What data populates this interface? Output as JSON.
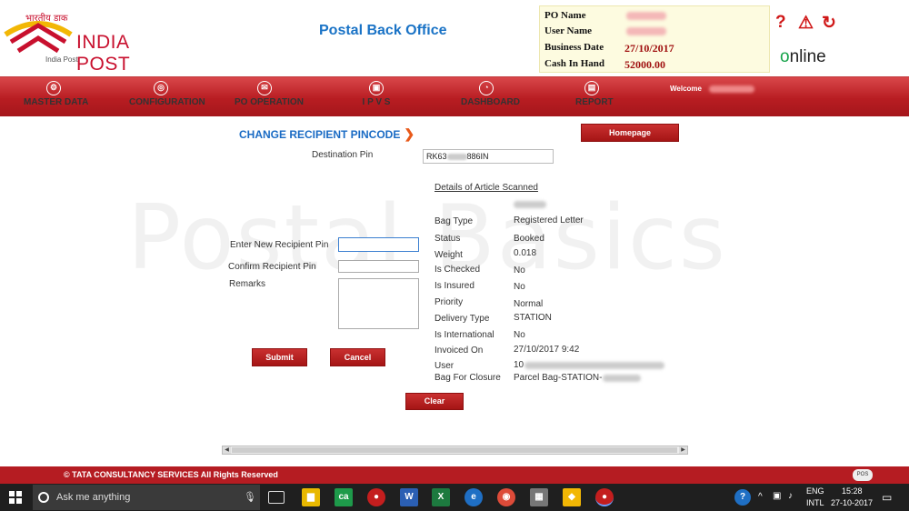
{
  "header": {
    "logo_hindi": "भारतीय डाक",
    "logo_brand": "INDIA POST",
    "logo_small": "India Post",
    "app_title": "Postal Back Office",
    "info": [
      {
        "label": "PO Name",
        "value": ""
      },
      {
        "label": "User Name",
        "value": ""
      },
      {
        "label": "Business Date",
        "value": "27/10/2017"
      },
      {
        "label": "Cash In Hand",
        "value": "52000.00"
      }
    ],
    "icons": [
      "help-icon",
      "warning-icon",
      "refresh-icon"
    ],
    "online_o": "o",
    "online_rest": "nline"
  },
  "nav": {
    "items": [
      "MASTER DATA",
      "CONFIGURATION",
      "PO OPERATION",
      "I P V S",
      "DASHBOARD",
      "REPORT"
    ],
    "welcome": "Welcome"
  },
  "watermark": "Postal Basics",
  "form": {
    "title": "CHANGE RECIPIENT PINCODE",
    "homepage_label": "Homepage",
    "destination_pin_label": "Destination Pin",
    "destination_pin_prefix": "RK63",
    "destination_pin_suffix": "886IN",
    "new_pin_label": "Enter New Recipient Pin",
    "confirm_pin_label": "Confirm Recipient Pin",
    "remarks_label": "Remarks",
    "submit_label": "Submit",
    "cancel_label": "Cancel",
    "clear_label": "Clear"
  },
  "details": {
    "heading": "Details of Article Scanned",
    "rows": [
      {
        "key": "Bag Type",
        "value": "Registered Letter"
      },
      {
        "key": "Status",
        "value": "Booked"
      },
      {
        "key": "Weight",
        "value": "0.018"
      },
      {
        "key": "Is Checked",
        "value": "No"
      },
      {
        "key": "Is Insured",
        "value": "No"
      },
      {
        "key": "Priority",
        "value": "Normal"
      },
      {
        "key": "Delivery Type",
        "value": "STATION"
      },
      {
        "key": "Is International",
        "value": "No"
      },
      {
        "key": "Invoiced On",
        "value": "27/10/2017 9:42"
      },
      {
        "key": "User",
        "value": "10"
      },
      {
        "key": "Bag For Closure",
        "value": "Parcel Bag-STATION-"
      }
    ]
  },
  "footer": {
    "copyright": "© TATA CONSULTANCY SERVICES    All Rights Reserved",
    "badge": "POS"
  },
  "taskbar": {
    "search_placeholder": "Ask me anything",
    "lang_top": "ENG",
    "lang_bottom": "INTL",
    "time": "15:28",
    "date": "27-10-2017"
  },
  "colors": {
    "brand_red": "#b81d22",
    "title_blue": "#1a73c6",
    "value_red": "#a01010"
  }
}
